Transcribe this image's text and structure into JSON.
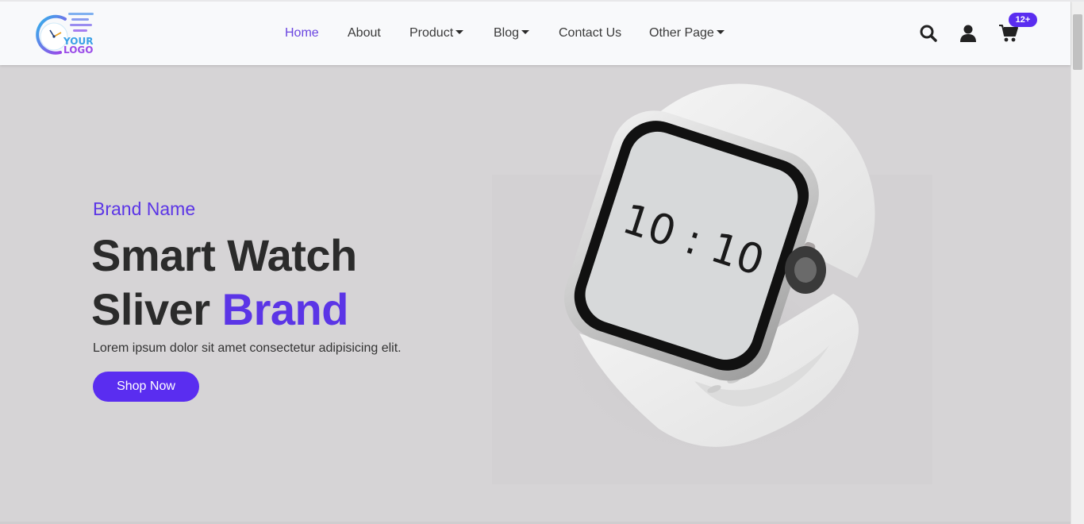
{
  "logo": {
    "line1": "YOUR",
    "line2": "LOGO"
  },
  "nav": {
    "home": "Home",
    "about": "About",
    "product": "Product",
    "blog": "Blog",
    "contact": "Contact Us",
    "other": "Other Page"
  },
  "header_icons": {
    "search": "search-icon",
    "user": "user-icon",
    "cart": "cart-icon",
    "cart_badge": "12+"
  },
  "hero": {
    "brand_name": "Brand Name",
    "title_line1": "Smart Watch",
    "title_line2_plain": "Sliver",
    "title_line2_accent": "Brand",
    "description": "Lorem ipsum dolor sit amet consectetur adipisicing elit.",
    "cta_label": "Shop Now",
    "watch_time": "10 : 10"
  },
  "colors": {
    "accent": "#5b35e6",
    "button": "#5a2df0",
    "nav_active": "#6a45e0",
    "hero_bg": "#d6d4d6",
    "header_bg": "#f8f9fb"
  }
}
